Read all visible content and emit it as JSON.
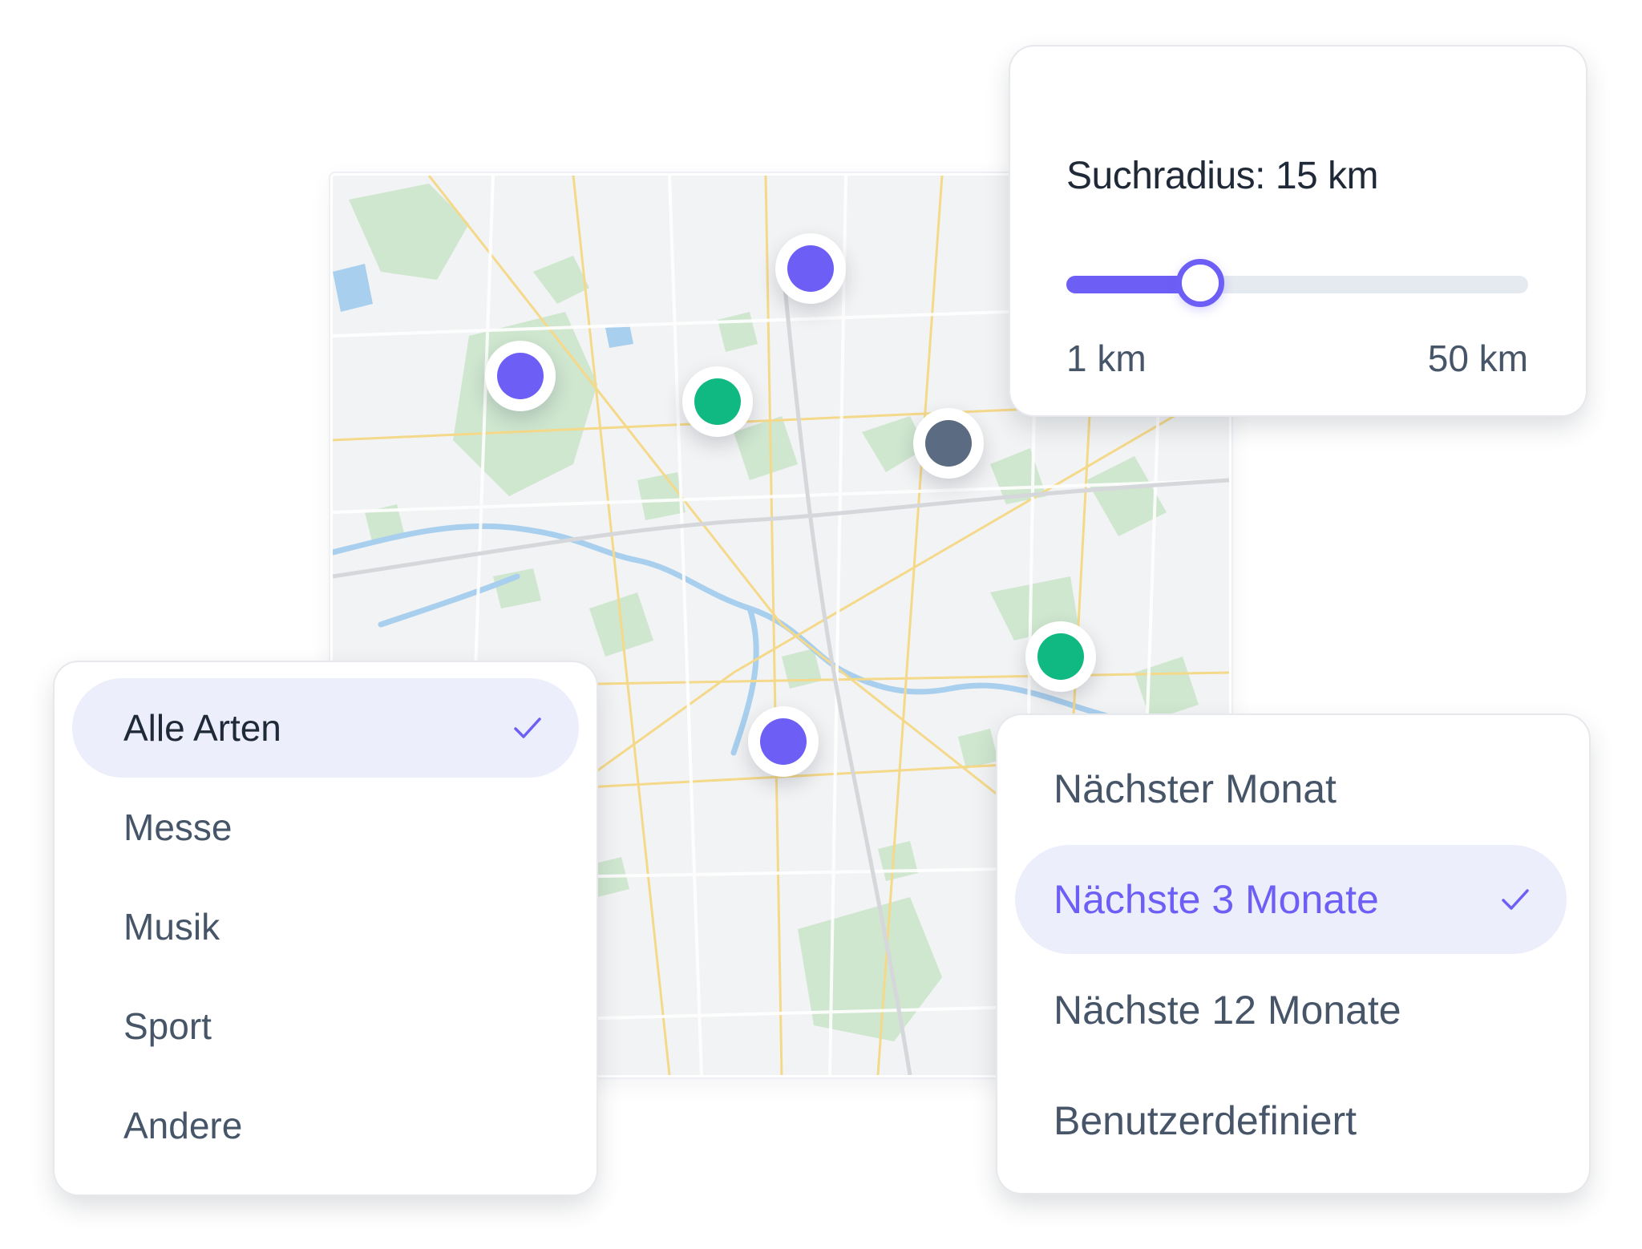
{
  "map": {
    "pins": [
      {
        "name": "map-pin-purple-1",
        "color": "#6d5ff5"
      },
      {
        "name": "map-pin-purple-2",
        "color": "#6d5ff5"
      },
      {
        "name": "map-pin-green-1",
        "color": "#10b981"
      },
      {
        "name": "map-pin-slate",
        "color": "#5b6b82"
      },
      {
        "name": "map-pin-green-2",
        "color": "#10b981"
      },
      {
        "name": "map-pin-purple-3",
        "color": "#6d5ff5"
      }
    ]
  },
  "radius": {
    "title": "Suchradius: 15 km",
    "min_label": "1 km",
    "max_label": "50 km",
    "value_fraction": 0.29
  },
  "type_menu": {
    "items": [
      {
        "label": "Alle Arten",
        "selected": true
      },
      {
        "label": "Messe",
        "selected": false
      },
      {
        "label": "Musik",
        "selected": false
      },
      {
        "label": "Sport",
        "selected": false
      },
      {
        "label": "Andere",
        "selected": false
      }
    ]
  },
  "time_menu": {
    "items": [
      {
        "label": "Nächster Monat",
        "selected": false
      },
      {
        "label": "Nächste 3 Monate",
        "selected": true
      },
      {
        "label": "Nächste 12 Monate",
        "selected": false
      },
      {
        "label": "Benutzerdefiniert",
        "selected": false
      }
    ]
  },
  "colors": {
    "accent": "#6d5ff5",
    "green": "#10b981",
    "slate": "#5b6b82",
    "selected_bg": "#eceefc"
  }
}
